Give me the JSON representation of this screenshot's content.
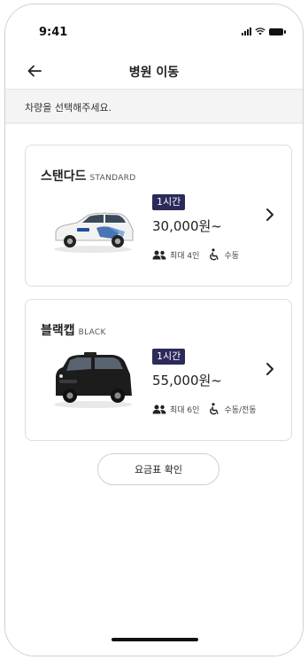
{
  "status_bar": {
    "time": "9:41"
  },
  "header": {
    "title": "병원 이동",
    "back_icon": "arrow-left-icon"
  },
  "instruction": "차량을 선택해주세요.",
  "vehicles": [
    {
      "name": "스탠다드",
      "name_en": "STANDARD",
      "duration_badge": "1시간",
      "price": "30,000원~",
      "capacity": "최대 4인",
      "wheelchair": "수동",
      "car_color": "#f2f2f2"
    },
    {
      "name": "블랙캡",
      "name_en": "BLACK",
      "duration_badge": "1시간",
      "price": "55,000원~",
      "capacity": "최대 6인",
      "wheelchair": "수동/전동",
      "car_color": "#1c1c1c"
    }
  ],
  "fare_button": "요금표 확인",
  "colors": {
    "badge_bg": "#2c2a5b",
    "background": "#f4f4f4"
  }
}
